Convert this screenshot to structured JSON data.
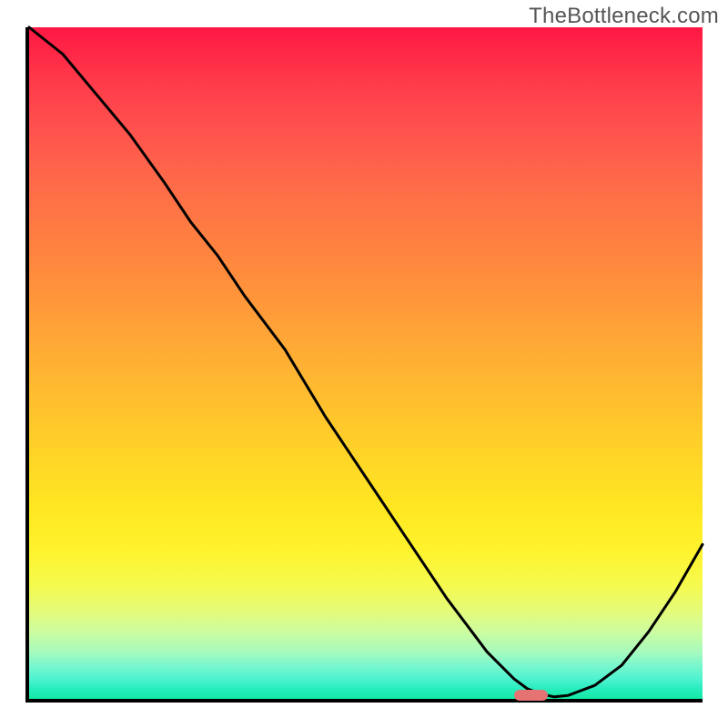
{
  "attribution": "TheBottleneck.com",
  "chart_data": {
    "type": "line",
    "title": "",
    "xlabel": "",
    "ylabel": "",
    "xlim": [
      0,
      100
    ],
    "ylim": [
      0,
      100
    ],
    "x": [
      0,
      5,
      10,
      15,
      20,
      24,
      28,
      32,
      38,
      44,
      50,
      56,
      62,
      68,
      72,
      74,
      76,
      78,
      80,
      84,
      88,
      92,
      96,
      100
    ],
    "values": [
      100,
      96,
      90,
      84,
      77,
      71,
      66,
      60,
      52,
      42,
      33,
      24,
      15,
      7,
      3,
      1.5,
      0.7,
      0.3,
      0.5,
      2,
      5,
      10,
      16,
      23
    ],
    "marker": {
      "x": 74.5,
      "width": 5,
      "y": 0.5
    },
    "background": "rainbow-gradient"
  }
}
